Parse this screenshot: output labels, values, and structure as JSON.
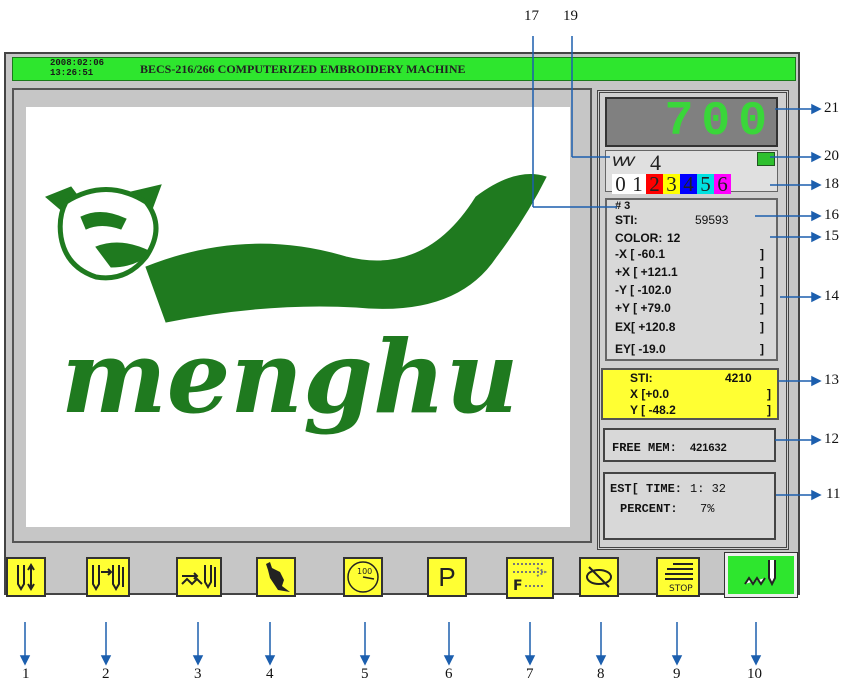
{
  "header": {
    "date": "2008:02:06",
    "time": "13:26:51",
    "title": "BECS-216/266 COMPUTERIZED EMBROIDERY MACHINE"
  },
  "design": {
    "logo_text": "menghu",
    "logo_color": "#1f7a1f"
  },
  "panel": {
    "speed": "700",
    "needle_count": "4",
    "color_indices": [
      "0",
      "1",
      "2",
      "3",
      "4",
      "5",
      "6"
    ],
    "color_index_colors": [
      "#ffffff",
      "#ffffff",
      "#ff0000",
      "#ffff00",
      "#0000ff",
      "#00e0e0",
      "#ff00ff",
      "#ffffff"
    ],
    "needle_no": "# 3",
    "sti_label": "STI:",
    "sti_value": "59593",
    "color_label": "COLOR:",
    "color_value": "12",
    "neg_x": "-X [ -60.1",
    "pos_x": "+X [ +121.1",
    "neg_y": "-Y [ -102.0",
    "pos_y": "+Y [ +79.0",
    "ex": "EX[ +120.8",
    "ey": "EY[ -19.0",
    "bracket": "]",
    "cur_sti_label": "STI:",
    "cur_sti_value": "4210",
    "cur_x": "X [+0.0",
    "cur_y": "Y [ -48.2",
    "free_mem_label": "FREE MEM:",
    "free_mem_value": "421632",
    "est_time_label": "EST[ TIME:",
    "est_time_value": "1: 32",
    "percent_label": "PERCENT:",
    "percent_value": "7%"
  },
  "toolbar": {
    "p_label": "P",
    "stop_label": "STOP",
    "f_label": "F",
    "speed_dial_label": "100"
  },
  "callouts": {
    "bottom": [
      "1",
      "2",
      "3",
      "4",
      "5",
      "6",
      "7",
      "8",
      "9",
      "10"
    ],
    "right": [
      "21",
      "20",
      "18",
      "16",
      "15",
      "14",
      "13",
      "12",
      "11"
    ],
    "top": [
      "17",
      "19"
    ]
  }
}
